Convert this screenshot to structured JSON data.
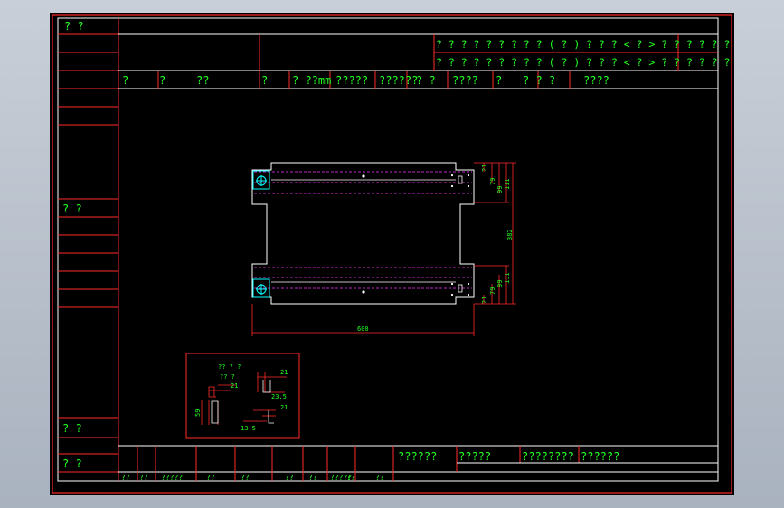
{
  "colors": {
    "frame": "#ff2a2a",
    "text": "#22ff22",
    "white": "#ffffff",
    "cyan": "#00ffff",
    "magenta": "#ff33ff",
    "background": "#000000",
    "window": "#b8c0cc"
  },
  "left_strip": {
    "top": "?   ?",
    "mid": "?   ?",
    "bottom1": "?   ?",
    "bottom2": "?   ?"
  },
  "header": {
    "revision_row1": "? ? ? ?  ? ?  ? ?  ? ( ? ) ? ? ? < ? > ? ? ? ? ? ? ? ?",
    "revision_row2": "? ? ? ?  ? ?  ? ?  ? ( ? ) ? ? ? < ? > ? ? ? ? ? ? ? ?",
    "label_row": [
      "?",
      "?",
      "??",
      "?",
      "?  ??mm",
      "?????",
      "??????",
      "?  ?",
      "????",
      "?",
      "?  ?  ?",
      "????"
    ]
  },
  "drawing": {
    "dimensions": {
      "overall_width": "600",
      "height_total": "382",
      "right_top": [
        "21",
        "79",
        "99",
        "111"
      ],
      "right_bottom": [
        "21",
        "79",
        "99",
        "111"
      ]
    },
    "detail_box": {
      "title": "?? ? ?",
      "subtitle": "?? ?",
      "dims": [
        "21",
        "59",
        "21",
        "23.5",
        "21",
        "13.5"
      ]
    }
  },
  "title_block": {
    "right_titles": [
      "??????",
      "?????",
      "????????",
      "??????"
    ],
    "bottom_cells": [
      "??",
      "??",
      "?????",
      "??",
      "??",
      "??",
      "??",
      "?????",
      "??",
      "??"
    ]
  }
}
